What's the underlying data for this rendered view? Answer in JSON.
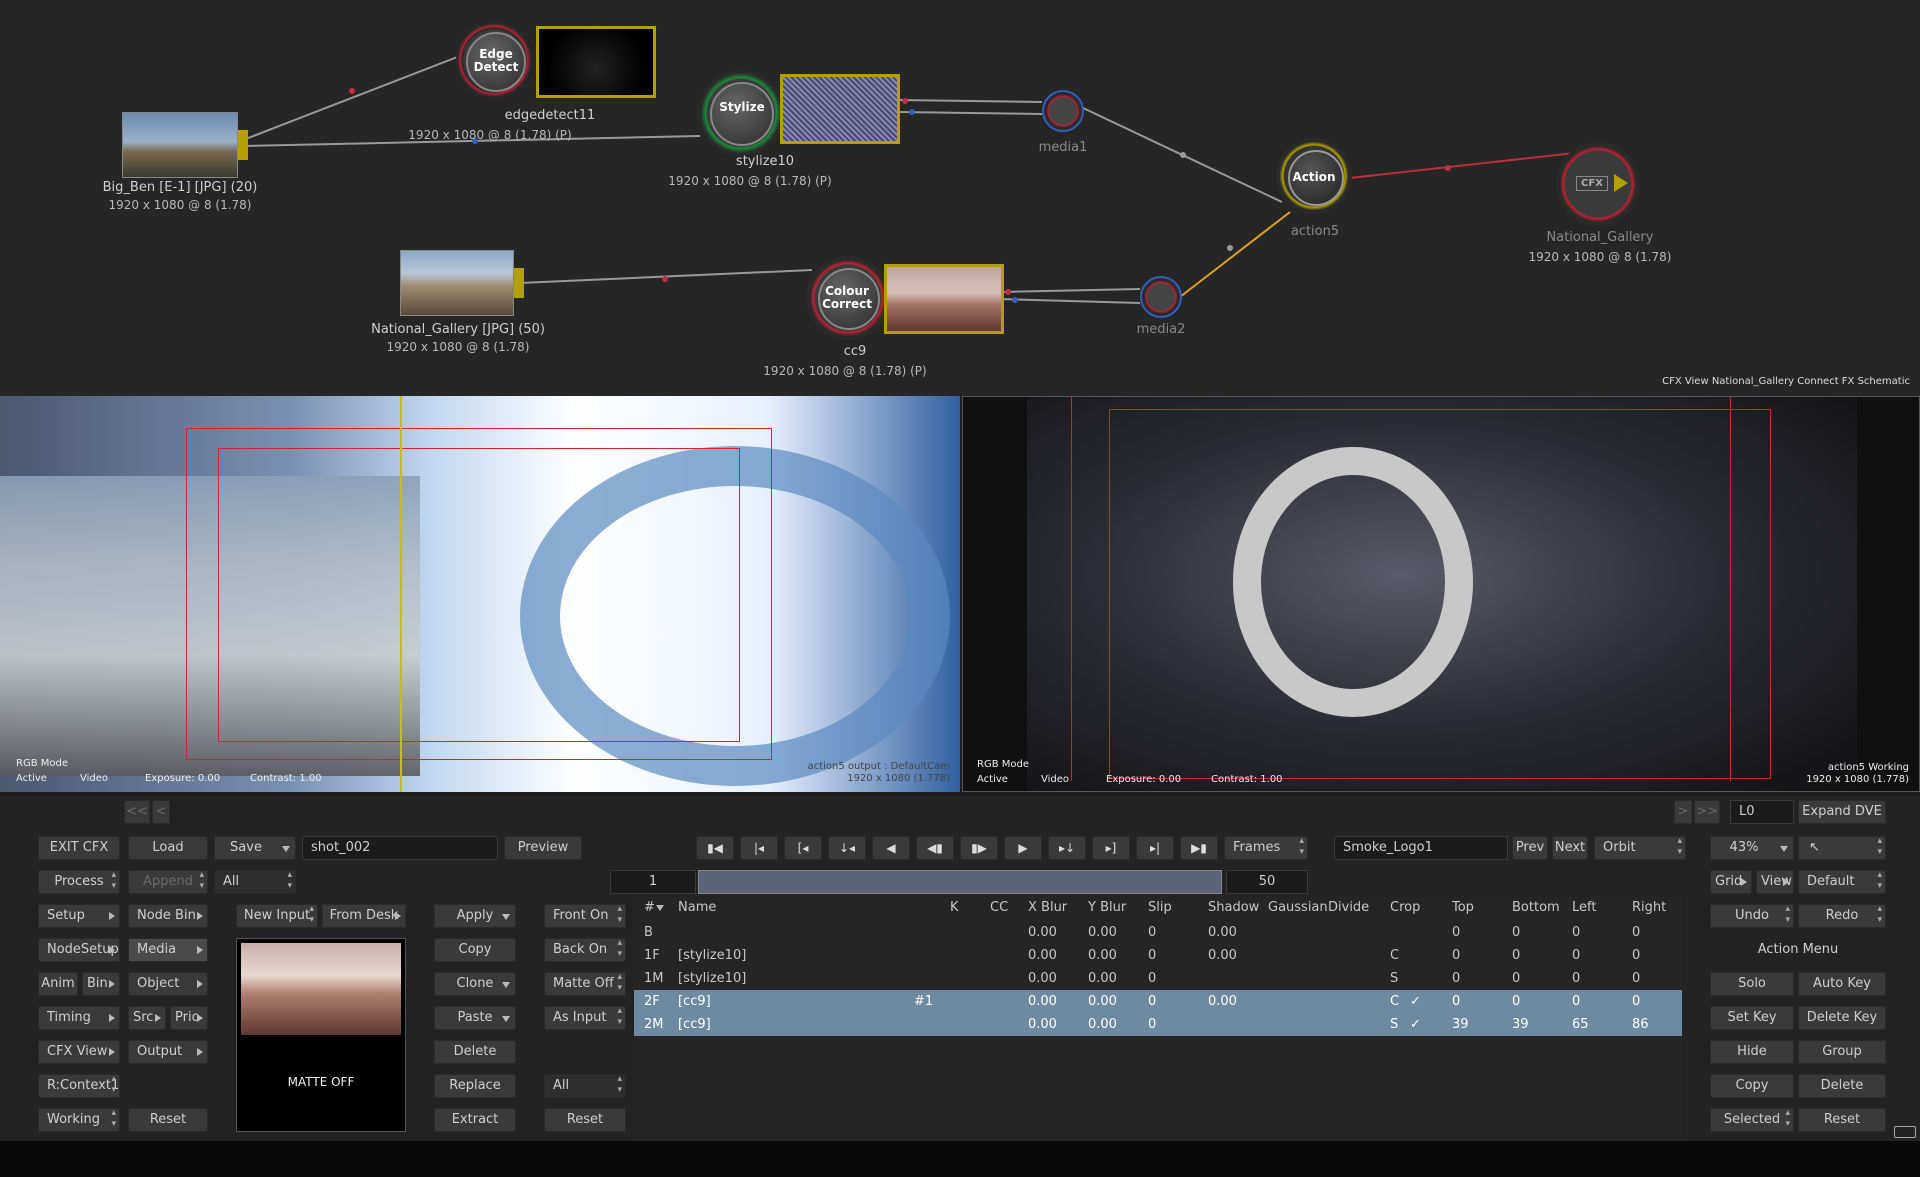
{
  "schematic": {
    "nodes": {
      "big_ben": {
        "label": "Big_Ben [E-1] [JPG] (20)",
        "res": "1920 x 1080 @ 8 (1.78)"
      },
      "edgedetect": {
        "title": "Edge\nDetect",
        "label": "edgedetect11",
        "res": "1920 x 1080 @ 8 (1.78) (P)"
      },
      "stylize": {
        "title": "Stylize",
        "label": "stylize10",
        "res": "1920 x 1080 @ 8 (1.78) (P)"
      },
      "media1": {
        "label": "media1"
      },
      "action": {
        "title": "Action",
        "label": "action5"
      },
      "national_gallery_out": {
        "title": "CFX",
        "label": "National_Gallery",
        "res": "1920 x 1080 @ 8 (1.78)"
      },
      "national_gallery_src": {
        "label": "National_Gallery [JPG] (50)",
        "res": "1920 x 1080 @ 8 (1.78)"
      },
      "cc": {
        "title": "Colour\nCorrect",
        "label": "cc9",
        "res": "1920 x 1080 @ 8 (1.78) (P)"
      },
      "media2": {
        "label": "media2"
      }
    },
    "caption": "CFX View National_Gallery Connect FX Schematic"
  },
  "viewer_left": {
    "mode": "RGB Mode",
    "status": [
      "Active",
      "Video",
      "Exposure: 0.00",
      "Contrast: 1.00"
    ],
    "info1": "action5 output : DefaultCam",
    "info2": "1920 x 1080 (1.778)"
  },
  "viewer_right": {
    "mode": "RGB Mode",
    "status": [
      "Active",
      "Video",
      "Exposure: 0.00",
      "Contrast: 1.00"
    ],
    "info1": "action5 Working",
    "info2": "1920 x 1080 (1.778)"
  },
  "panel": {
    "nav_prev": "<<",
    "nav_prev2": "<",
    "nav_next": ">",
    "nav_next2": ">>",
    "layer_field": "L0",
    "expand_dve": "Expand DVE",
    "exit_cfx": "EXIT CFX",
    "load": "Load",
    "save": "Save",
    "setup_name": "shot_002",
    "preview": "Preview",
    "process": "Process",
    "append": "Append",
    "all1": "All",
    "setup": "Setup",
    "node_bin": "Node Bin",
    "nodesetup": "NodeSetup",
    "media": "Media",
    "anim": "Anim",
    "bin": "Bin",
    "object": "Object",
    "timing": "Timing",
    "src": "Src",
    "prio": "Prio",
    "cfx_view": "CFX View",
    "output": "Output",
    "rcontext": "R:Context1",
    "working": "Working",
    "reset1": "Reset",
    "new_input": "New Input",
    "from_desk": "From Desk",
    "matte_off": "MATTE OFF",
    "apply": "Apply",
    "copy1": "Copy",
    "clone": "Clone",
    "paste": "Paste",
    "delete1": "Delete",
    "replace": "Replace",
    "extract": "Extract",
    "front_on": "Front On",
    "back_on": "Back On",
    "matte_off_btn": "Matte Off",
    "as_input": "As Input",
    "all2": "All",
    "reset2": "Reset",
    "frames": "Frames",
    "frame_start": "1",
    "frame_end": "50",
    "smoke_logo": "Smoke_Logo1",
    "prev": "Prev",
    "next": "Next",
    "orbit": "Orbit",
    "zoom": "43%",
    "grid": "Grid",
    "view": "View",
    "default": "Default",
    "undo": "Undo",
    "redo": "Redo",
    "action_menu": "Action Menu",
    "solo": "Solo",
    "auto_key": "Auto Key",
    "set_key": "Set Key",
    "delete_key": "Delete Key",
    "hide": "Hide",
    "group": "Group",
    "copy2": "Copy",
    "delete2": "Delete",
    "selected": "Selected",
    "reset3": "Reset"
  },
  "table": {
    "headers": [
      "#",
      "Name",
      "K",
      "CC",
      "X Blur",
      "Y Blur",
      "Slip",
      "Shadow",
      "Gaussian",
      "Divide",
      "Crop",
      "Top",
      "Bottom",
      "Left",
      "Right"
    ],
    "rows": [
      {
        "id": "B",
        "name": "",
        "tag": "",
        "xblur": "0.00",
        "yblur": "0.00",
        "slip": "0",
        "shadow": "0.00",
        "crop": "",
        "check": "",
        "top": "0",
        "bottom": "0",
        "left": "0",
        "right": "0"
      },
      {
        "id": "1F",
        "name": "[stylize10]",
        "tag": "",
        "xblur": "0.00",
        "yblur": "0.00",
        "slip": "0",
        "shadow": "0.00",
        "crop": "C",
        "check": "",
        "top": "0",
        "bottom": "0",
        "left": "0",
        "right": "0"
      },
      {
        "id": "1M",
        "name": "[stylize10]",
        "tag": "",
        "xblur": "0.00",
        "yblur": "0.00",
        "slip": "0",
        "shadow": "",
        "crop": "S",
        "check": "",
        "top": "0",
        "bottom": "0",
        "left": "0",
        "right": "0"
      },
      {
        "id": "2F",
        "name": "[cc9]",
        "tag": "#1",
        "xblur": "0.00",
        "yblur": "0.00",
        "slip": "0",
        "shadow": "0.00",
        "crop": "C",
        "check": "✓",
        "top": "0",
        "bottom": "0",
        "left": "0",
        "right": "0"
      },
      {
        "id": "2M",
        "name": "[cc9]",
        "tag": "",
        "xblur": "0.00",
        "yblur": "0.00",
        "slip": "0",
        "shadow": "",
        "crop": "S",
        "check": "✓",
        "top": "39",
        "bottom": "39",
        "left": "65",
        "right": "86"
      }
    ]
  },
  "colors": {
    "accent_yellow": "#b5a000",
    "selected_row": "#6d8aa0",
    "wire_red": "#c0303a",
    "wire_orange": "#e0a020"
  }
}
